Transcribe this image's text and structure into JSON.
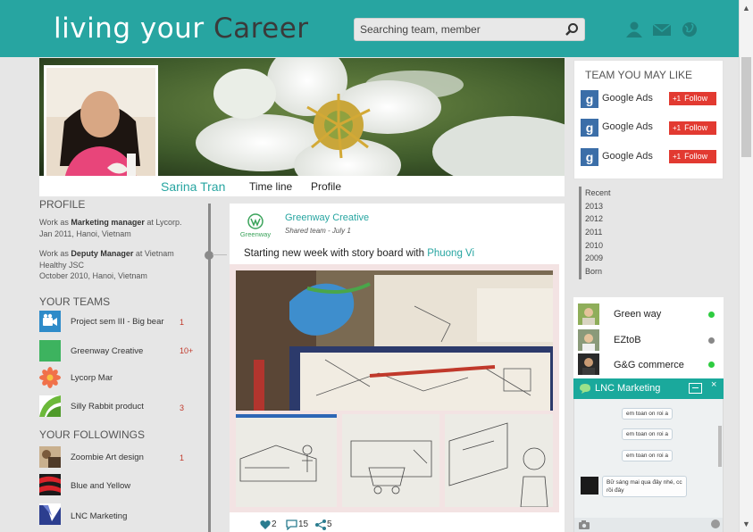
{
  "header": {
    "logo_part1": "living your",
    "logo_part2": "Career",
    "search_placeholder": "Searching team, member",
    "icons": [
      "user-icon",
      "mail-icon",
      "globe-icon"
    ],
    "accent_color": "#27a5a1"
  },
  "profile": {
    "name": "Sarina Tran",
    "tabs": [
      "Time line",
      "Profile"
    ]
  },
  "left": {
    "profile_title": "PROFILE",
    "jobs": [
      {
        "prefix": "Work as ",
        "role": "Marketing manager",
        "suffix": " at Lycorp.",
        "line2": "Jan 2011, Hanoi, Vietnam"
      },
      {
        "prefix": "Work as ",
        "role": "Deputy Manager",
        "suffix": " at Vietnam",
        "line2": "Healthy JSC",
        "line3": "October 2010, Hanoi, Vietnam"
      }
    ],
    "teams_title": "YOUR TEAMS",
    "teams": [
      {
        "label": "Project sem III - Big bear",
        "count": "1",
        "icon": "video-camera-icon"
      },
      {
        "label": "Greenway Creative",
        "count": "10+",
        "icon": "green-square-icon"
      },
      {
        "label": "Lycorp Mar",
        "count": "",
        "icon": "flower-icon"
      },
      {
        "label": "Silly Rabbit product",
        "count": "3",
        "icon": "green-leaf-icon"
      }
    ],
    "followings_title": "YOUR FOLLOWINGS",
    "followings": [
      {
        "label": "Zoombie Art design",
        "count": "1"
      },
      {
        "label": "Blue and Yellow",
        "count": ""
      },
      {
        "label": "LNC Marketing",
        "count": ""
      }
    ]
  },
  "post": {
    "author": "Greenway Creative",
    "logo_text": "Greenway",
    "subtitle": "Shared team - July 1",
    "text": "Starting new week with story board with ",
    "mention": "Phuong Vi",
    "likes": "2",
    "comments": "15",
    "shares": "5"
  },
  "right": {
    "suggest_title": "TEAM YOU MAY LIKE",
    "suggestions": [
      {
        "label": "Google Ads",
        "button": "Follow"
      },
      {
        "label": "Google Ads",
        "button": "Follow"
      },
      {
        "label": "Google Ads",
        "button": "Follow"
      }
    ],
    "years": [
      "Recent",
      "2013",
      "2012",
      "2011",
      "2010",
      "2009",
      "Born"
    ],
    "online": [
      {
        "label": "Green way",
        "status_color": "#2ecc40"
      },
      {
        "label": "EZtoB",
        "status_color": "#888888"
      },
      {
        "label": "G&G commerce",
        "status_color": "#2ecc40"
      }
    ]
  },
  "chat": {
    "title": "LNC Marketing",
    "close": "×",
    "messages": [
      "em toan on roi a",
      "em toan on roi a",
      "em toan on roi a"
    ],
    "reply_line1": "Bữ sáng mai qua đây nhé, cc",
    "reply_line2": "rồi đây"
  }
}
